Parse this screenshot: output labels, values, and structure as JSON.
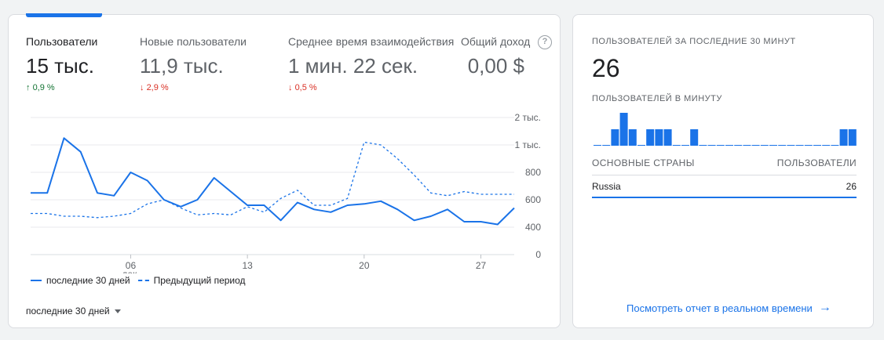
{
  "metrics": [
    {
      "label": "Пользователи",
      "value": "15 тыс.",
      "delta": "0,9 %",
      "direction": "up"
    },
    {
      "label": "Новые пользователи",
      "value": "11,9 тыс.",
      "delta": "2,9 %",
      "direction": "down"
    },
    {
      "label": "Среднее время взаимодействия",
      "value": "1 мин. 22 сек.",
      "delta": "0,5 %",
      "direction": "down"
    },
    {
      "label": "Общий доход",
      "value": "0,00 $",
      "delta": "",
      "direction": ""
    }
  ],
  "help_icon": "question-mark",
  "chart_data": {
    "type": "line",
    "x_ticks": [
      {
        "day": 6,
        "label": "06",
        "sublabel": "дек."
      },
      {
        "day": 13,
        "label": "13",
        "sublabel": ""
      },
      {
        "day": 20,
        "label": "20",
        "sublabel": ""
      },
      {
        "day": 27,
        "label": "27",
        "sublabel": ""
      }
    ],
    "x_start_day": 30,
    "x": [
      30,
      1,
      2,
      3,
      4,
      5,
      6,
      7,
      8,
      9,
      10,
      11,
      12,
      13,
      14,
      15,
      16,
      17,
      18,
      19,
      20,
      21,
      22,
      23,
      24,
      25,
      26,
      27,
      28,
      29
    ],
    "y_ticks": [
      {
        "value": 0,
        "label": "0"
      },
      {
        "value": 400,
        "label": "400"
      },
      {
        "value": 600,
        "label": "600"
      },
      {
        "value": 800,
        "label": "800"
      },
      {
        "value": 1000,
        "label": "1 тыс."
      },
      {
        "value": 2000,
        "label": "2 тыс."
      }
    ],
    "y_scale": "non-linear per tick labels",
    "grid": true,
    "series": [
      {
        "name": "последние 30 дней",
        "style": "solid",
        "color": "#1a73e8",
        "values": [
          650,
          650,
          1250,
          950,
          650,
          630,
          800,
          740,
          600,
          550,
          600,
          760,
          660,
          560,
          560,
          450,
          580,
          530,
          510,
          560,
          570,
          590,
          530,
          450,
          480,
          530,
          440,
          440,
          420,
          540
        ]
      },
      {
        "name": "Предыдущий период",
        "style": "dashed",
        "color": "#1a73e8",
        "values": [
          500,
          500,
          480,
          480,
          470,
          480,
          500,
          570,
          600,
          540,
          490,
          500,
          490,
          550,
          510,
          610,
          670,
          560,
          560,
          610,
          1100,
          1000,
          900,
          780,
          650,
          630,
          660,
          640,
          640,
          640
        ]
      }
    ],
    "legend_position": "bottom-left"
  },
  "legend": {
    "current": "последние 30 дней",
    "previous": "Предыдущий период"
  },
  "range_select": "последние 30 дней",
  "realtime": {
    "title": "ПОЛЬЗОВАТЕЛЕЙ ЗА ПОСЛЕДНИЕ 30 МИНУТ",
    "value": "26",
    "per_minute_title": "ПОЛЬЗОВАТЕЛЕЙ В МИНУТУ",
    "per_minute_values": [
      0,
      0,
      1,
      2,
      1,
      0,
      1,
      1,
      1,
      0,
      0,
      1,
      0,
      0,
      0,
      0,
      0,
      0,
      0,
      0,
      0,
      0,
      0,
      0,
      0,
      0,
      0,
      0,
      1,
      1
    ],
    "table_headers": [
      "ОСНОВНЫЕ СТРАНЫ",
      "ПОЛЬЗОВАТЕЛИ"
    ],
    "rows": [
      {
        "country": "Russia",
        "users": "26"
      }
    ],
    "link": "Посмотреть отчет в реальном времени"
  },
  "colors": {
    "accent": "#1a73e8",
    "up": "#137333",
    "down": "#d93025",
    "grid": "#e8eaed"
  }
}
